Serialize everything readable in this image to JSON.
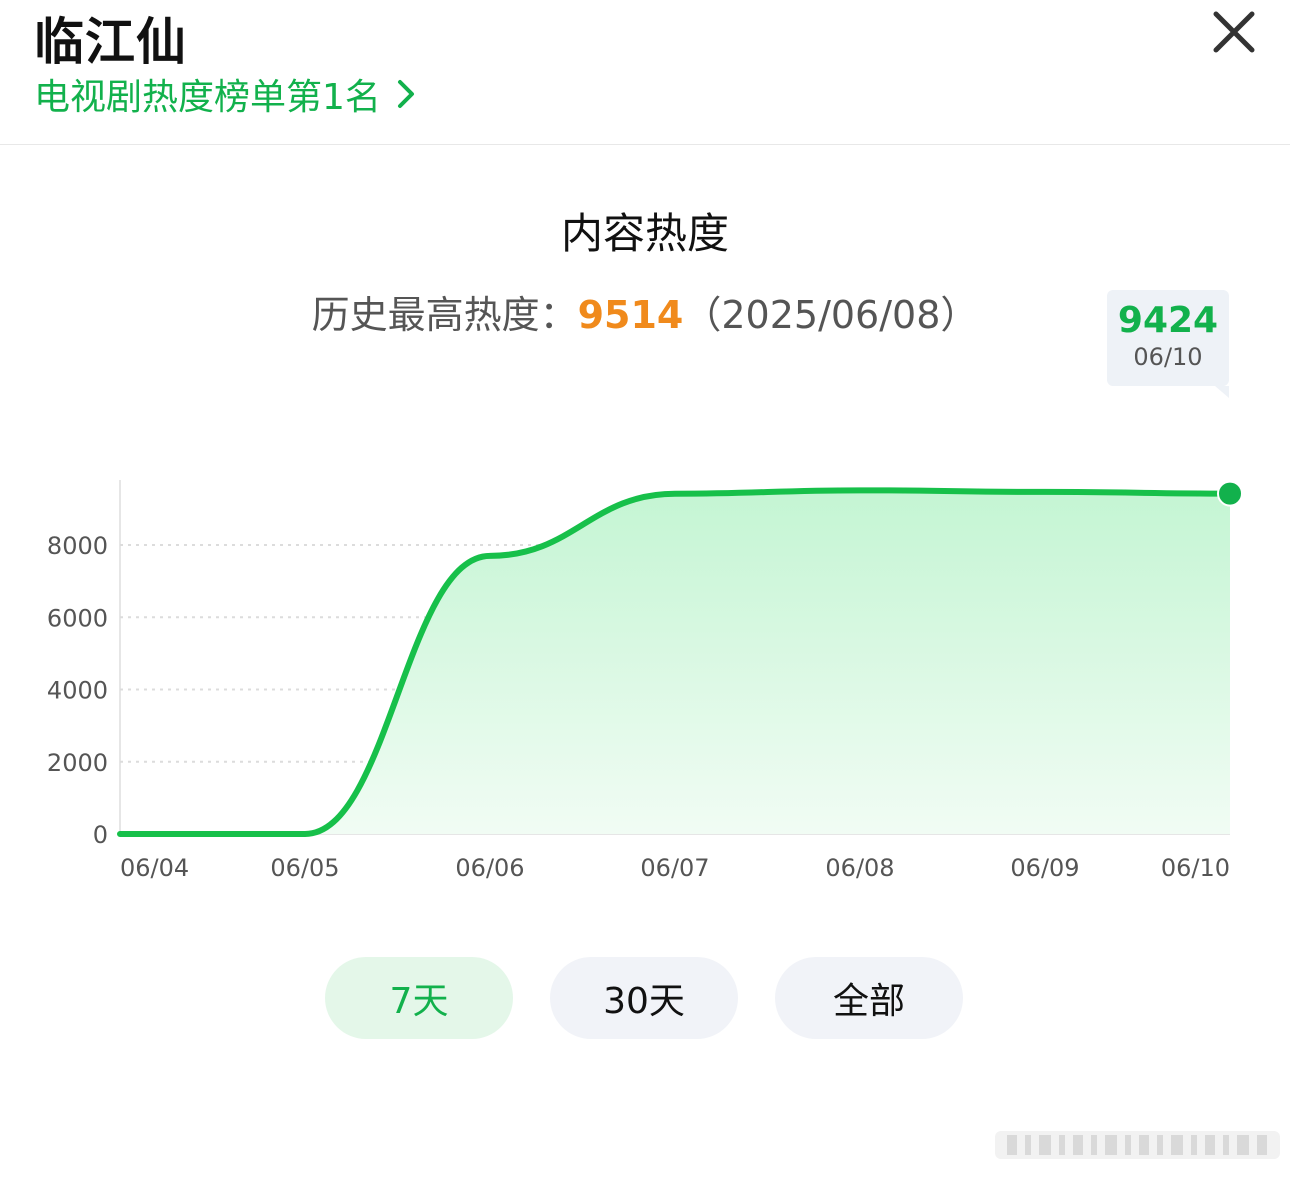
{
  "header": {
    "title": "临江仙",
    "rank_link": "电视剧热度榜单第1名"
  },
  "summary": {
    "chart_title": "内容热度",
    "peak_label": "历史最高热度：",
    "peak_value": "9514",
    "peak_date": "（2025/06/08）"
  },
  "tooltip": {
    "value": "9424",
    "date": "06/10"
  },
  "range_buttons": [
    {
      "label": "7天",
      "active": true
    },
    {
      "label": "30天",
      "active": false
    },
    {
      "label": "全部",
      "active": false
    }
  ],
  "colors": {
    "accent": "#12b14c",
    "line": "#17c04a",
    "peak": "#f08a1c"
  },
  "chart_data": {
    "type": "area",
    "x": [
      "06/04",
      "06/05",
      "06/06",
      "06/07",
      "06/08",
      "06/09",
      "06/10"
    ],
    "series": [
      {
        "values": [
          0,
          0,
          7700,
          9420,
          9514,
          9470,
          9424
        ]
      }
    ],
    "yticks": [
      0,
      2000,
      4000,
      6000,
      8000
    ],
    "ylim": [
      0,
      9800
    ],
    "grid": true,
    "highlight_point": {
      "x": "06/10",
      "y": 9424
    }
  }
}
